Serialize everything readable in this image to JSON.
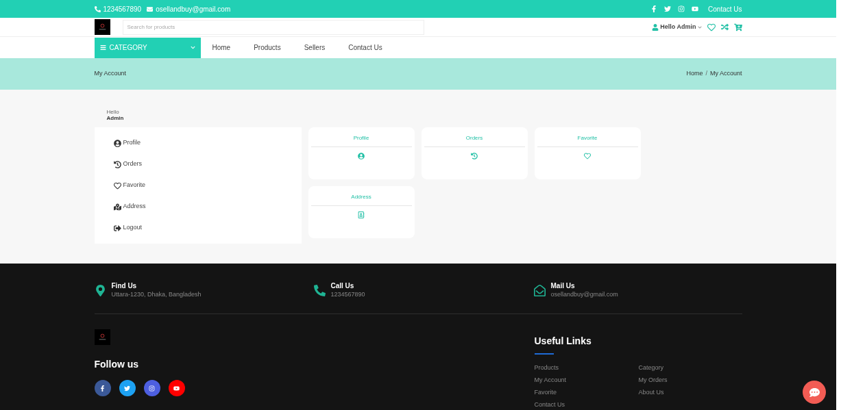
{
  "top_bar": {
    "phone": "1234567890",
    "email": "osellandbuy@gmail.com",
    "contact_link": "Contact Us"
  },
  "header": {
    "search": {
      "placeholder": "Search for products"
    },
    "user_greeting": "Hello Admin"
  },
  "nav": {
    "category_button": "CATEGORY",
    "links": [
      "Home",
      "Products",
      "Sellers",
      "Contact Us"
    ]
  },
  "breadcrumb": {
    "title": "My Account",
    "trail": [
      "Home",
      "My Account"
    ],
    "separator": "/"
  },
  "account": {
    "greeting": "Hello",
    "name": "Admin",
    "menu": [
      {
        "kind": "profile",
        "label": "Profile"
      },
      {
        "kind": "orders",
        "label": "Orders"
      },
      {
        "kind": "favorite",
        "label": "Favorite"
      },
      {
        "kind": "address",
        "label": "Address"
      },
      {
        "kind": "logout",
        "label": "Logout"
      }
    ],
    "cards": [
      {
        "kind": "profile",
        "title": "Profile"
      },
      {
        "kind": "orders",
        "title": "Orders"
      },
      {
        "kind": "favorite",
        "title": "Favorite"
      },
      {
        "kind": "address",
        "title": "Address"
      }
    ]
  },
  "footer": {
    "contacts": [
      {
        "kind": "location",
        "title": "Find Us",
        "value": "Uttara-1230, Dhaka, Bangladesh"
      },
      {
        "kind": "phone",
        "title": "Call Us",
        "value": "1234567890"
      },
      {
        "kind": "mail",
        "title": "Mail Us",
        "value": "osellandbuy@gmail.com"
      }
    ],
    "follow_title": "Follow us",
    "useful_links_title": "Useful Links",
    "links": [
      "Products",
      "Category",
      "My Account",
      "My Orders",
      "Favorite",
      "About Us",
      "Contact Us"
    ]
  }
}
